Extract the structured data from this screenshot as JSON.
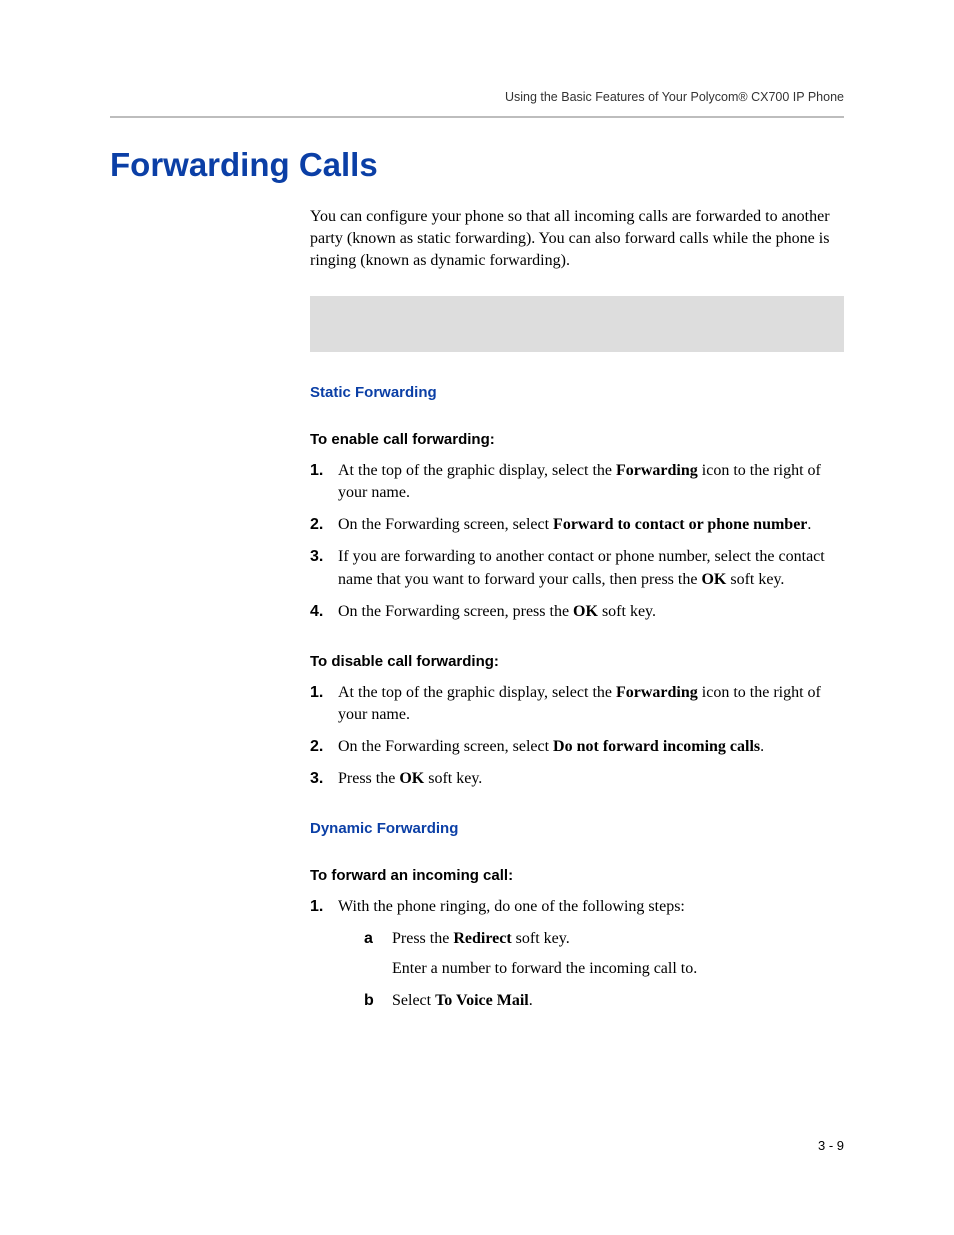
{
  "running_head": "Using the Basic Features of Your Polycom® CX700 IP Phone",
  "title": "Forwarding Calls",
  "intro": "You can configure your phone so that all incoming calls are forwarded to another party (known as static forwarding). You can also forward calls while the phone is ringing (known as dynamic forwarding).",
  "sections": {
    "static": {
      "heading": "Static Forwarding",
      "enable": {
        "heading": "To enable call forwarding:",
        "steps": {
          "s1a": "At the top of the graphic display, select the ",
          "s1b": "Forwarding",
          "s1c": " icon to the right of your name.",
          "s2a": "On the Forwarding screen, select ",
          "s2b": "Forward to contact or phone number",
          "s2c": ".",
          "s3a": "If you are forwarding to another contact or phone number, select the contact name that you want to forward your calls, then press the ",
          "s3b": "OK",
          "s3c": " soft key.",
          "s4a": "On the Forwarding screen, press the ",
          "s4b": "OK",
          "s4c": " soft key."
        }
      },
      "disable": {
        "heading": "To disable call forwarding:",
        "steps": {
          "s1a": "At the top of the graphic display, select the ",
          "s1b": "Forwarding",
          "s1c": " icon to the right of your name.",
          "s2a": "On the Forwarding screen, select ",
          "s2b": "Do not forward incoming calls",
          "s2c": ".",
          "s3a": "Press the ",
          "s3b": "OK",
          "s3c": " soft key."
        }
      }
    },
    "dynamic": {
      "heading": "Dynamic Forwarding",
      "forward": {
        "heading": "To forward an incoming call:",
        "s1": "With the phone ringing, do one of the following steps:",
        "sub": {
          "a1": "Press the ",
          "a2": "Redirect",
          "a3": " soft key.",
          "a_extra": "Enter a number to forward the incoming call to.",
          "b1": "Select ",
          "b2": "To Voice Mail",
          "b3": "."
        }
      }
    }
  },
  "page_number": "3 - 9"
}
